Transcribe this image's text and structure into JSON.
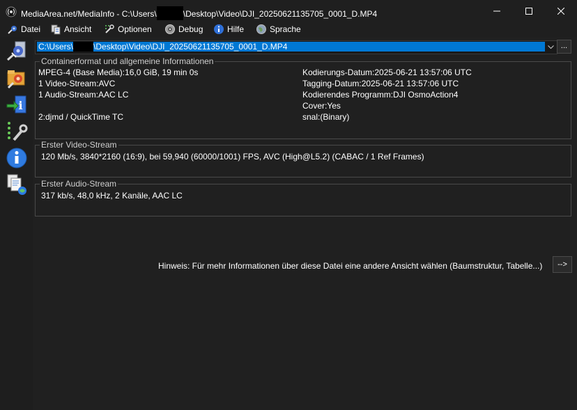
{
  "window": {
    "title": "MediaArea.net/MediaInfo - C:\\Users\\",
    "title_suffix": "\\Desktop\\Video\\DJI_20250621135705_0001_D.MP4",
    "icon": "mediainfo-app-icon"
  },
  "menu": {
    "items": [
      {
        "label": "Datei",
        "icon": "file-icon"
      },
      {
        "label": "Ansicht",
        "icon": "view-icon"
      },
      {
        "label": "Optionen",
        "icon": "options-icon"
      },
      {
        "label": "Debug",
        "icon": "debug-icon"
      },
      {
        "label": "Hilfe",
        "icon": "help-icon"
      },
      {
        "label": "Sprache",
        "icon": "language-icon"
      }
    ]
  },
  "sidebar": {
    "buttons": [
      "open-file-icon",
      "open-folder-icon",
      "export-icon",
      "preferences-icon",
      "about-icon",
      "knowledge-base-icon"
    ]
  },
  "file": {
    "path_prefix": "C:\\Users\\",
    "path_suffix": "\\Desktop\\Video\\DJI_20250621135705_0001_D.MP4",
    "browse_label": "..."
  },
  "general": {
    "title": "Containerformat und allgemeine Informationen",
    "left": [
      "MPEG-4 (Base Media):16,0 GiB, 19 min 0s",
      "1 Video-Stream:AVC",
      "1 Audio-Stream:AAC LC",
      "",
      "2:djmd / QuickTime TC"
    ],
    "right": [
      "Kodierungs-Datum:2025-06-21 13:57:06 UTC",
      "Tagging-Datum:2025-06-21 13:57:06 UTC",
      "Kodierendes Programm:DJI OsmoAction4",
      "Cover:Yes",
      "snal:(Binary)"
    ]
  },
  "video": {
    "title": "Erster Video-Stream",
    "info": "120 Mb/s, 3840*2160 (16:9), bei 59,940 (60000/1001) FPS, AVC (High@L5.2) (CABAC / 1 Ref Frames)"
  },
  "audio": {
    "title": "Erster Audio-Stream",
    "info": "317 kb/s, 48,0 kHz, 2 Kanäle, AAC LC"
  },
  "hint": {
    "text": "Hinweis: Für mehr Informationen über diese Datei eine andere Ansicht wählen (Baumstruktur, Tabelle...)",
    "button": "-->"
  }
}
